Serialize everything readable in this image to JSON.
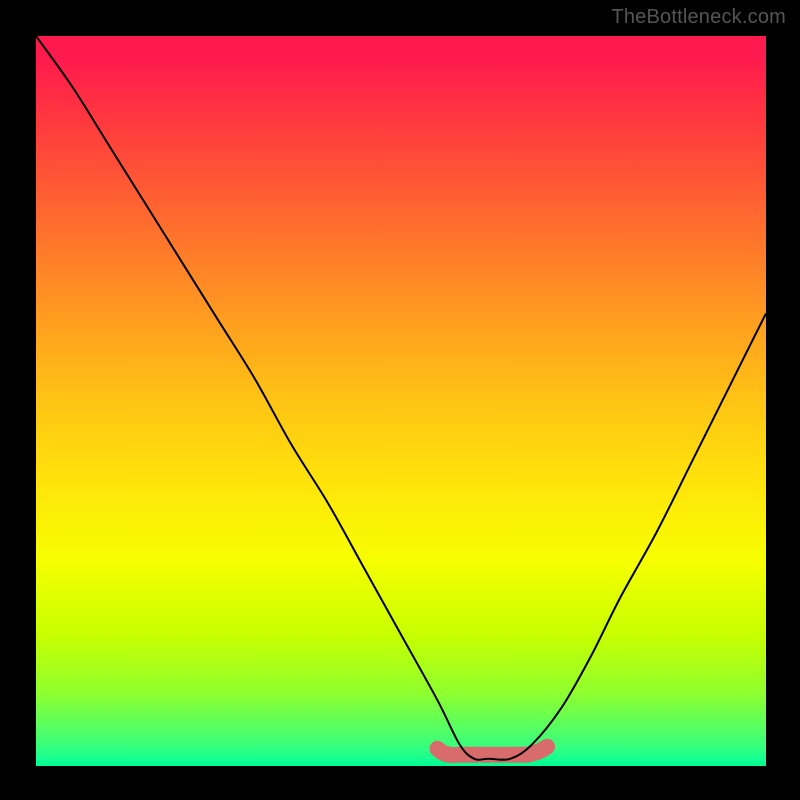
{
  "watermark": "TheBottleneck.com",
  "chart_data": {
    "type": "line",
    "title": "",
    "xlabel": "",
    "ylabel": "",
    "xlim": [
      0,
      1
    ],
    "ylim": [
      0,
      1
    ],
    "series": [
      {
        "name": "curve",
        "x": [
          0.0,
          0.05,
          0.1,
          0.15,
          0.2,
          0.25,
          0.3,
          0.35,
          0.4,
          0.45,
          0.5,
          0.55,
          0.58,
          0.6,
          0.62,
          0.65,
          0.68,
          0.72,
          0.76,
          0.8,
          0.85,
          0.9,
          0.95,
          1.0
        ],
        "y": [
          1.0,
          0.93,
          0.85,
          0.77,
          0.69,
          0.61,
          0.53,
          0.44,
          0.36,
          0.27,
          0.18,
          0.09,
          0.03,
          0.01,
          0.01,
          0.01,
          0.03,
          0.08,
          0.15,
          0.23,
          0.32,
          0.42,
          0.52,
          0.62
        ]
      }
    ],
    "valley_segment": {
      "x_start": 0.55,
      "x_end": 0.7,
      "y": 0.01,
      "color": "#d86b6b",
      "stroke_width": 16
    },
    "colors": {
      "gradient_top": "#ff1a4d",
      "gradient_bottom": "#04ff9b",
      "curve": "#000000",
      "frame": "#000000"
    }
  }
}
